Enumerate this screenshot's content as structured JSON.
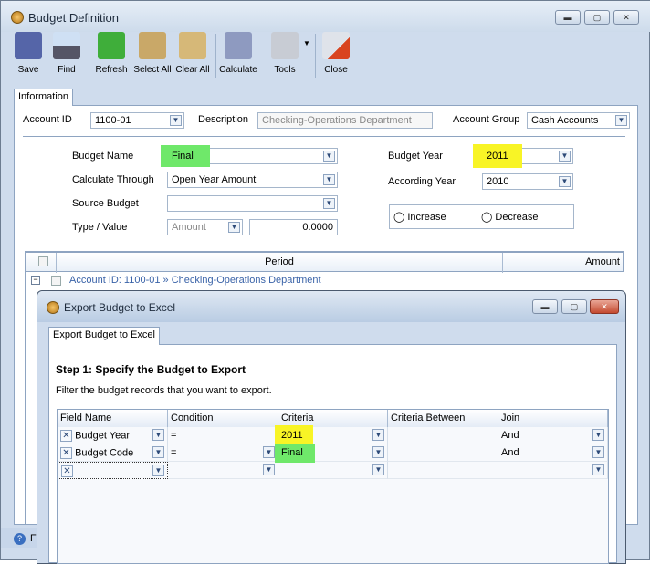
{
  "main_window": {
    "title": "Budget Definition",
    "controls": [
      "minimize",
      "maximize",
      "close"
    ]
  },
  "toolbar": {
    "items": [
      {
        "label": "Save",
        "icon": "floppy-disk-icon"
      },
      {
        "label": "Find",
        "icon": "binoculars-icon"
      },
      {
        "label": "Refresh",
        "icon": "refresh-icon"
      },
      {
        "label": "Select All",
        "icon": "clipboard-check-icon"
      },
      {
        "label": "Clear All",
        "icon": "clipboard-eraser-icon"
      },
      {
        "label": "Calculate",
        "icon": "calculator-icon"
      },
      {
        "label": "Tools",
        "icon": "tools-icon"
      },
      {
        "label": "Close",
        "icon": "close-window-icon"
      }
    ]
  },
  "tab": "Information",
  "form": {
    "account_id_label": "Account ID",
    "account_id": "1100-01",
    "description_label": "Description",
    "description": "Checking-Operations Department",
    "account_group_label": "Account Group",
    "account_group": "Cash Accounts",
    "budget_name_label": "Budget Name",
    "budget_name": "Final",
    "calculate_through_label": "Calculate Through",
    "calculate_through": "Open Year Amount",
    "source_budget_label": "Source Budget",
    "source_budget": "",
    "type_value_label": "Type / Value",
    "type": "Amount",
    "value": "0.0000",
    "budget_year_label": "Budget Year",
    "budget_year": "2011",
    "according_year_label": "According Year",
    "according_year": "2010",
    "increase_label": "Increase",
    "decrease_label": "Decrease"
  },
  "grid": {
    "columns": [
      "Period",
      "Amount"
    ],
    "group_row": "Account ID: 1100-01 » Checking-Operations Department"
  },
  "status_bar": {
    "text": "F"
  },
  "dialog": {
    "title": "Export Budget to Excel",
    "tab": "Export Budget to Excel",
    "step_title": "Step 1: Specify the Budget to Export",
    "instruction": "Filter the budget records that you want to export.",
    "columns": [
      "Field Name",
      "Condition",
      "Criteria",
      "Criteria Between",
      "Join"
    ],
    "rows": [
      {
        "field": "Budget Year",
        "condition": "=",
        "criteria": "2011",
        "between": "",
        "join": "And"
      },
      {
        "field": "Budget Code",
        "condition": "=",
        "criteria": "Final",
        "between": "",
        "join": "And"
      },
      {
        "field": "",
        "condition": "",
        "criteria": "",
        "between": "",
        "join": ""
      }
    ]
  },
  "colors": {
    "highlight_yellow": "#f8f426",
    "highlight_green": "#6fe86a",
    "link_blue": "#3a63a8"
  }
}
